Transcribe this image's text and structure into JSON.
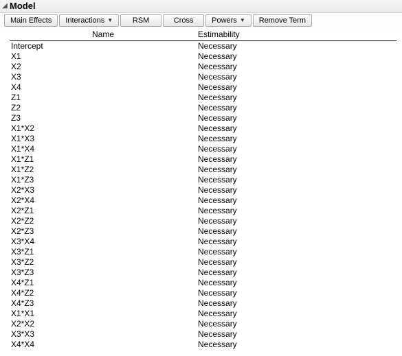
{
  "panel": {
    "title": "Model",
    "disclosure_glyph": "◢"
  },
  "toolbar": {
    "main_effects": "Main Effects",
    "interactions": "Interactions",
    "rsm": "RSM",
    "cross": "Cross",
    "powers": "Powers",
    "remove_term": "Remove Term",
    "caret": "▼"
  },
  "columns": {
    "name": "Name",
    "estimability": "Estimability"
  },
  "rows": [
    {
      "name": "Intercept",
      "estimability": "Necessary"
    },
    {
      "name": "X1",
      "estimability": "Necessary"
    },
    {
      "name": "X2",
      "estimability": "Necessary"
    },
    {
      "name": "X3",
      "estimability": "Necessary"
    },
    {
      "name": "X4",
      "estimability": "Necessary"
    },
    {
      "name": "Z1",
      "estimability": "Necessary"
    },
    {
      "name": "Z2",
      "estimability": "Necessary"
    },
    {
      "name": "Z3",
      "estimability": "Necessary"
    },
    {
      "name": "X1*X2",
      "estimability": "Necessary"
    },
    {
      "name": "X1*X3",
      "estimability": "Necessary"
    },
    {
      "name": "X1*X4",
      "estimability": "Necessary"
    },
    {
      "name": "X1*Z1",
      "estimability": "Necessary"
    },
    {
      "name": "X1*Z2",
      "estimability": "Necessary"
    },
    {
      "name": "X1*Z3",
      "estimability": "Necessary"
    },
    {
      "name": "X2*X3",
      "estimability": "Necessary"
    },
    {
      "name": "X2*X4",
      "estimability": "Necessary"
    },
    {
      "name": "X2*Z1",
      "estimability": "Necessary"
    },
    {
      "name": "X2*Z2",
      "estimability": "Necessary"
    },
    {
      "name": "X2*Z3",
      "estimability": "Necessary"
    },
    {
      "name": "X3*X4",
      "estimability": "Necessary"
    },
    {
      "name": "X3*Z1",
      "estimability": "Necessary"
    },
    {
      "name": "X3*Z2",
      "estimability": "Necessary"
    },
    {
      "name": "X3*Z3",
      "estimability": "Necessary"
    },
    {
      "name": "X4*Z1",
      "estimability": "Necessary"
    },
    {
      "name": "X4*Z2",
      "estimability": "Necessary"
    },
    {
      "name": "X4*Z3",
      "estimability": "Necessary"
    },
    {
      "name": "X1*X1",
      "estimability": "Necessary"
    },
    {
      "name": "X2*X2",
      "estimability": "Necessary"
    },
    {
      "name": "X3*X3",
      "estimability": "Necessary"
    },
    {
      "name": "X4*X4",
      "estimability": "Necessary"
    }
  ]
}
